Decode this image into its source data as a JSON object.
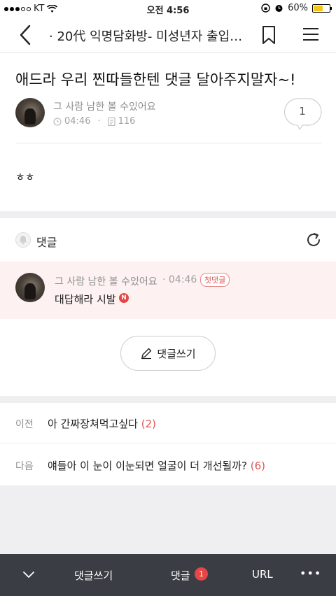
{
  "status_bar": {
    "carrier": "KT",
    "time": "오전 4:56",
    "battery": "60%",
    "battery_level": 0.6
  },
  "nav": {
    "title": "· 20代 익명담화방- 미성년자 출입…",
    "icons": [
      "back-chevron-icon",
      "bookmark-icon",
      "hamburger-menu-icon"
    ]
  },
  "post": {
    "title": "애드라 우리 찐따들한텐 댓글 달아주지말자~!",
    "author": "그 사람 남한 볼 수있어요",
    "time": "04:46",
    "views": "116",
    "comment_count": "1",
    "body": "ㅎㅎ"
  },
  "comments": {
    "header": "댓글",
    "items": [
      {
        "author": "그 사람 남한 볼 수있어요",
        "time": "04:46",
        "badge": "첫댓글",
        "text": "대답해라 시발",
        "new_badge": "N"
      }
    ],
    "write_button": "댓글쓰기"
  },
  "navigation": {
    "prev": {
      "label": "이전",
      "title": "아 간짜장쳐먹고싶다",
      "count": "(2)"
    },
    "next": {
      "label": "다음",
      "title": "얘들아 이 눈이 이눈되면 얼굴이 더 개선될까?",
      "count": "(6)"
    }
  },
  "toolbar": {
    "write": "댓글쓰기",
    "comment": "댓글",
    "comment_count": "1",
    "url": "URL",
    "more": "•••"
  },
  "colors": {
    "accent_red": "#e84545",
    "comment_highlight": "#fdf1f1",
    "toolbar_bg": "#3b3d44",
    "page_bg": "#efeff2"
  }
}
